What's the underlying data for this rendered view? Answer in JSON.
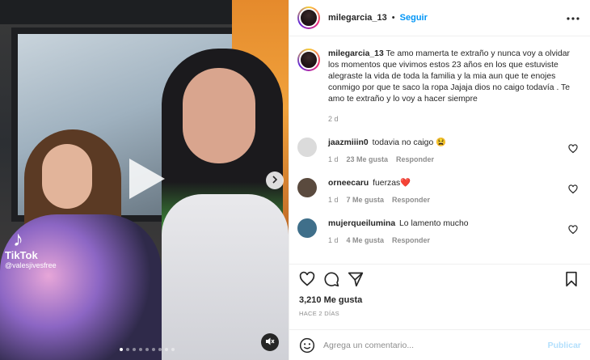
{
  "header": {
    "username": "milegarcia_13",
    "separator": "•",
    "follow_label": "Seguir",
    "more_icon": "more-horizontal-icon"
  },
  "media": {
    "tiktok_label": "TikTok",
    "tiktok_handle": "@valesjivesfree",
    "carousel_dots": 9,
    "active_dot": 0,
    "icons": [
      "play-icon",
      "chevron-right-icon",
      "mute-icon",
      "tiktok-icon"
    ]
  },
  "caption": {
    "username": "milegarcia_13",
    "text": "Te amo mamerta te extraño y nunca voy a olvidar los momentos que vivimos estos 23 años en los que estuviste alegraste la vida de toda la familia y la mia aun que te enojes conmigo por que te saco la ropa Jajaja dios no caigo todavía . Te amo te extraño y lo voy a hacer siempre",
    "time": "2 d"
  },
  "comments": [
    {
      "username": "jaazmiiin0",
      "text": "todavia no caigo 😫",
      "time": "1 d",
      "likes": "23 Me gusta",
      "reply": "Responder",
      "avatar_color": "#dbdbdb"
    },
    {
      "username": "orneecaru",
      "text": "fuerzas❤️",
      "time": "1 d",
      "likes": "7 Me gusta",
      "reply": "Responder",
      "avatar_color": "#5a4a3e"
    },
    {
      "username": "mujerqueilumina",
      "text": "Lo lamento mucho",
      "time": "1 d",
      "likes": "4 Me gusta",
      "reply": "Responder",
      "avatar_color": "#3f6f8a"
    }
  ],
  "actions": {
    "likes": "3,210 Me gusta",
    "post_time": "HACE 2 DÍAS"
  },
  "add_comment": {
    "placeholder": "Agrega un comentario...",
    "publish_label": "Publicar"
  },
  "colors": {
    "link_blue": "#0095f6",
    "publish_disabled": "#b2dffc",
    "secondary_text": "#8e8e8e",
    "divider": "#efefef"
  }
}
